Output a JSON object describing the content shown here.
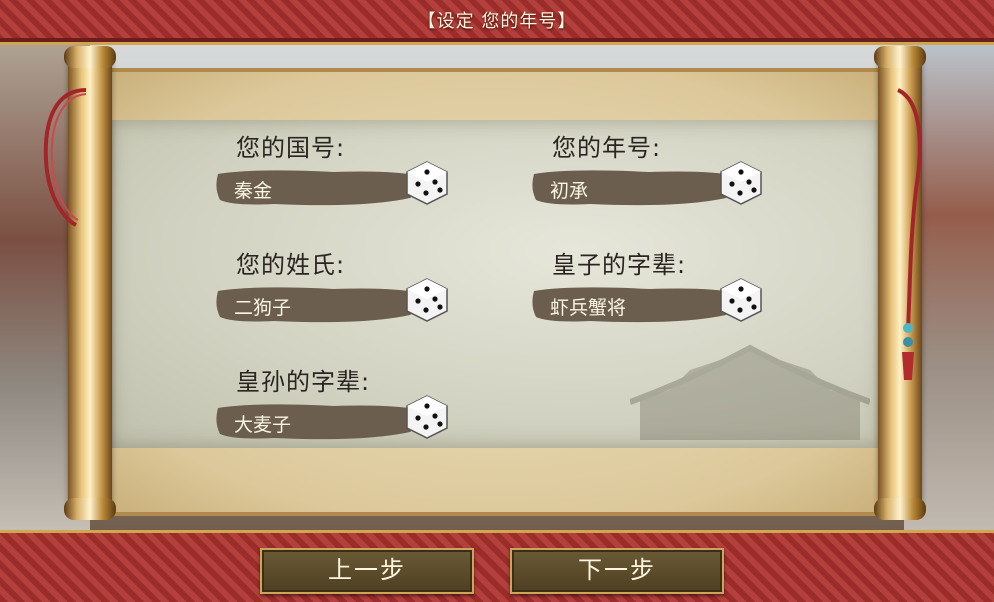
{
  "header": {
    "title": "【设定 您的年号】"
  },
  "fields": {
    "country": {
      "label": "您的国号:",
      "value": "秦金"
    },
    "era": {
      "label": "您的年号:",
      "value": "初承"
    },
    "surname": {
      "label": "您的姓氏:",
      "value": "二狗子"
    },
    "prince": {
      "label": "皇子的字辈:",
      "value": "虾兵蟹将"
    },
    "grandson": {
      "label": "皇孙的字辈:",
      "value": "大麦子"
    }
  },
  "footer": {
    "prev_label": "上一步",
    "next_label": "下一步"
  },
  "icons": {
    "randomize": "dice-icon"
  },
  "colors": {
    "banner": "#9a2c2a",
    "gold": "#d2a64f",
    "ink": "#6b5e4e"
  }
}
